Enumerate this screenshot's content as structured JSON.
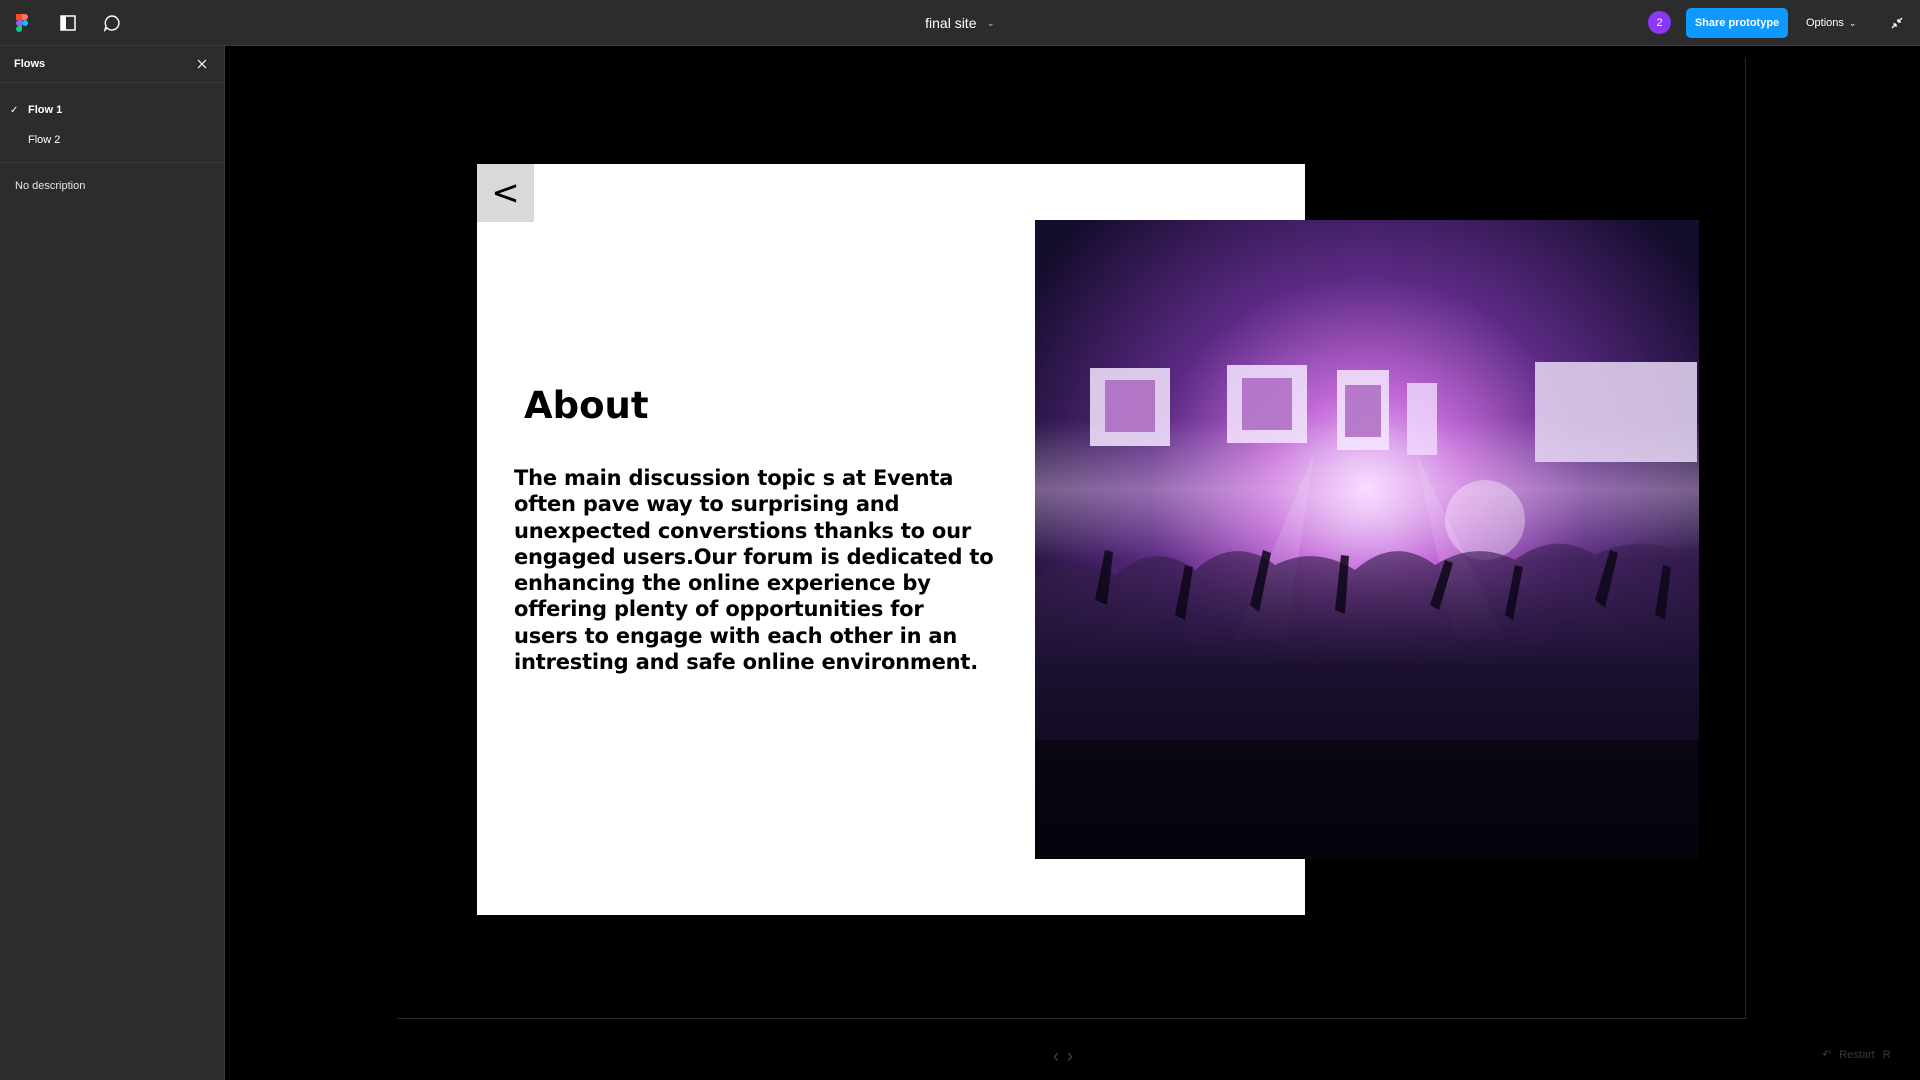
{
  "topbar": {
    "file_name": "final site",
    "avatar_count": "2",
    "share_label": "Share prototype",
    "options_label": "Options"
  },
  "sidebar": {
    "title": "Flows",
    "flows": [
      {
        "label": "Flow 1",
        "active": true
      },
      {
        "label": "Flow 2",
        "active": false
      }
    ],
    "description": "No description"
  },
  "frame": {
    "back_label": "<",
    "heading": "About",
    "body": "The main discussion topic s at Eventa often pave way to surprising  and unexpected converstions thanks to our engaged users.Our forum is dedicated to enhancing the online experience by offering plenty of opportunities for users to engage with each other in an intresting and safe online environment."
  },
  "footer": {
    "restart_label": "Restart",
    "restart_shortcut": "R"
  },
  "colors": {
    "accent": "#0d99ff",
    "avatar": "#8a38f5",
    "ui_bg": "#2c2c2c",
    "canvas_bg": "#000000"
  },
  "icons": [
    "figma-logo-icon",
    "sidebar-toggle-icon",
    "comment-icon",
    "chevron-down-icon",
    "close-icon",
    "check-icon",
    "collapse-icon",
    "arrow-left-icon",
    "arrow-right-icon",
    "restart-icon"
  ]
}
